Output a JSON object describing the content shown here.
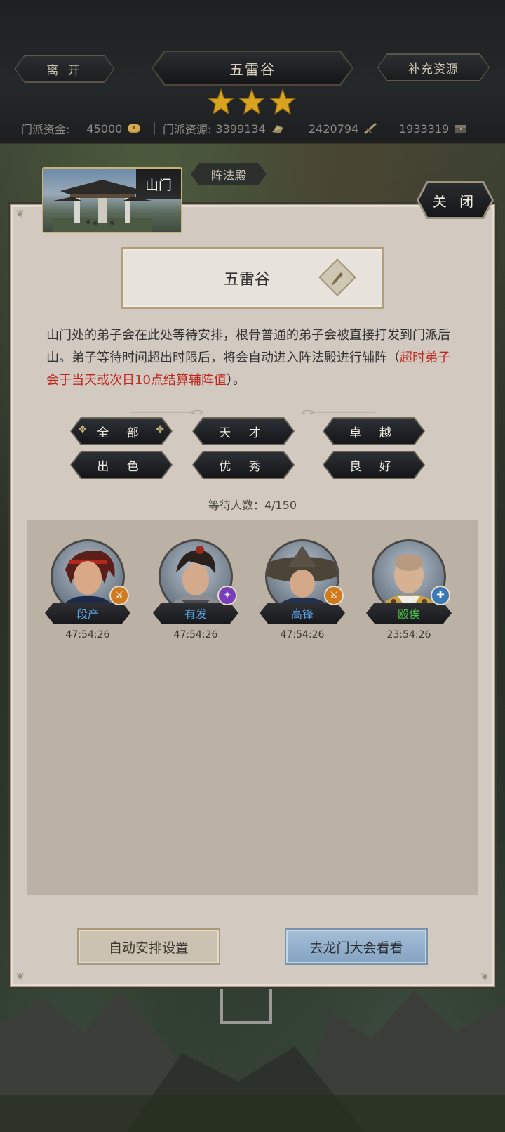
{
  "header": {
    "leave_label": "离 开",
    "location_title": "五雷谷",
    "replenish_label": "补充资源",
    "stars": 3,
    "resources": {
      "funds_label": "门派资金:",
      "funds_value": "45000",
      "resources_label": "门派资源:",
      "resources_value": "3399134",
      "res2_value": "2420794",
      "res3_value": "1933319"
    }
  },
  "tabs": {
    "shanmen_label": "山门",
    "zhenfa_label": "阵法殿"
  },
  "close_label": "关 闭",
  "panel": {
    "name_plate": "五雷谷",
    "desc_part1": "山门处的弟子会在此处等待安排，根骨普通的弟子会被直接打发到门派后山。弟子等待时间超出时限后，将会自动进入阵法殿进行辅阵（",
    "desc_red": "超时弟子会于当天或次日10点结算辅阵值",
    "desc_part2": "）。",
    "filters": [
      "全 部",
      "天 才",
      "卓 越",
      "出 色",
      "优 秀",
      "良 好"
    ],
    "wait_count": "等待人数：4/150",
    "disciples": [
      {
        "name": "段产",
        "timer": "47:54:26",
        "name_color": "#5aa2e6",
        "badge_color": "#d07a1e"
      },
      {
        "name": "有发",
        "timer": "47:54:26",
        "name_color": "#5aa2e6",
        "badge_color": "#7a3fb8"
      },
      {
        "name": "高锋",
        "timer": "47:54:26",
        "name_color": "#5aa2e6",
        "badge_color": "#d07a1e"
      },
      {
        "name": "殴俟",
        "timer": "23:54:26",
        "name_color": "#49c24a",
        "badge_color": "#3b78b8"
      }
    ],
    "auto_arrange_label": "自动安排设置",
    "go_dragon_gate_label": "去龙门大会看看"
  }
}
